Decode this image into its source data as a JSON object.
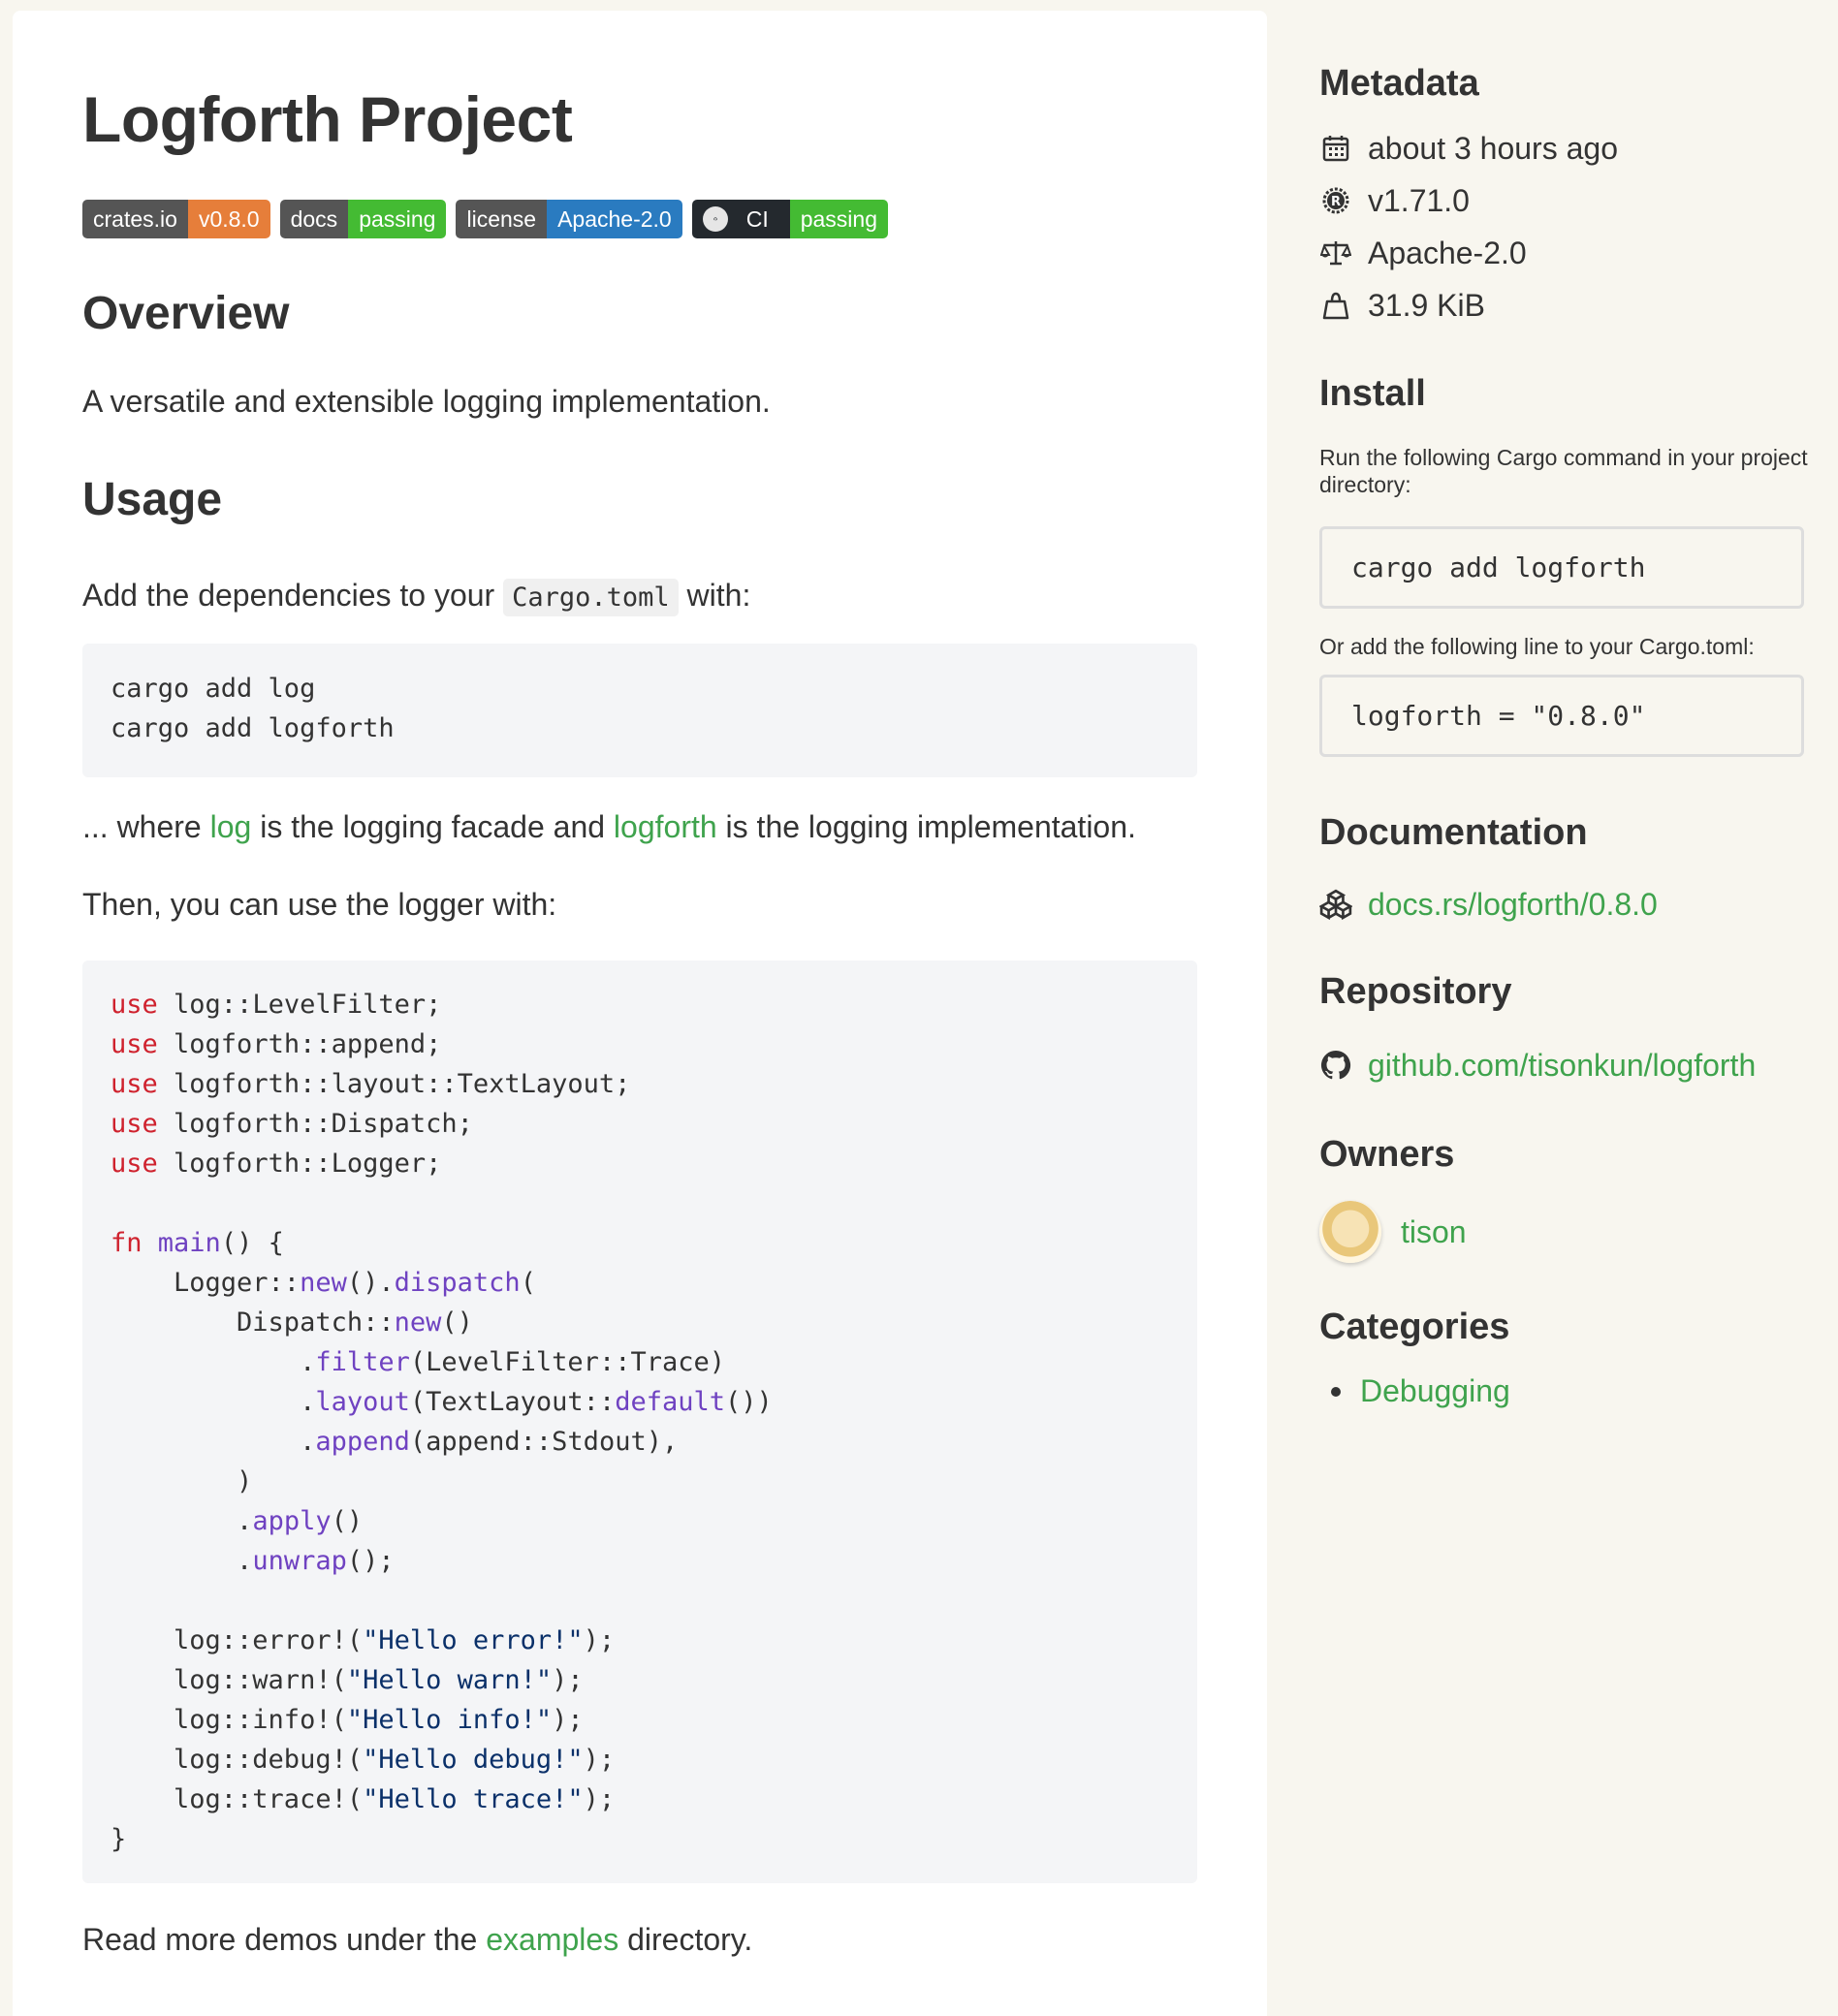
{
  "title": "Logforth Project",
  "badges": [
    {
      "left": "crates.io",
      "right": "v0.8.0"
    },
    {
      "left": "docs",
      "right": "passing"
    },
    {
      "left": "license",
      "right": "Apache-2.0"
    },
    {
      "left": "CI",
      "right": "passing"
    }
  ],
  "overview": {
    "heading": "Overview",
    "text": "A versatile and extensible logging implementation."
  },
  "usage": {
    "heading": "Usage",
    "add_text_before": "Add the dependencies to your ",
    "add_code": "Cargo.toml",
    "add_text_after": " with:",
    "cmd_lines": [
      "cargo add log",
      "cargo add logforth"
    ],
    "where_prefix": "... where ",
    "where_link1": "log",
    "where_mid": " is the logging facade and ",
    "where_link2": "logforth",
    "where_suffix": " is the logging implementation.",
    "then_text": "Then, you can use the logger with:",
    "read_prefix": "Read more demos under the ",
    "read_link": "examples",
    "read_suffix": " directory."
  },
  "code": [
    [
      [
        "kw",
        "use"
      ],
      [
        "t",
        " log::LevelFilter;"
      ]
    ],
    [
      [
        "kw",
        "use"
      ],
      [
        "t",
        " logforth::append;"
      ]
    ],
    [
      [
        "kw",
        "use"
      ],
      [
        "t",
        " logforth::layout::TextLayout;"
      ]
    ],
    [
      [
        "kw",
        "use"
      ],
      [
        "t",
        " logforth::Dispatch;"
      ]
    ],
    [
      [
        "kw",
        "use"
      ],
      [
        "t",
        " logforth::Logger;"
      ]
    ],
    [
      [
        "t",
        ""
      ]
    ],
    [
      [
        "kw",
        "fn"
      ],
      [
        "t",
        " "
      ],
      [
        "fn",
        "main"
      ],
      [
        "t",
        "() {"
      ]
    ],
    [
      [
        "t",
        "    Logger::"
      ],
      [
        "fn",
        "new"
      ],
      [
        "t",
        "()."
      ],
      [
        "fn",
        "dispatch"
      ],
      [
        "t",
        "("
      ]
    ],
    [
      [
        "t",
        "        Dispatch::"
      ],
      [
        "fn",
        "new"
      ],
      [
        "t",
        "()"
      ]
    ],
    [
      [
        "t",
        "            ."
      ],
      [
        "fn",
        "filter"
      ],
      [
        "t",
        "(LevelFilter::Trace)"
      ]
    ],
    [
      [
        "t",
        "            ."
      ],
      [
        "fn",
        "layout"
      ],
      [
        "t",
        "(TextLayout::"
      ],
      [
        "fn",
        "default"
      ],
      [
        "t",
        "())"
      ]
    ],
    [
      [
        "t",
        "            ."
      ],
      [
        "fn",
        "append"
      ],
      [
        "t",
        "(append::Stdout),"
      ]
    ],
    [
      [
        "t",
        "        )"
      ]
    ],
    [
      [
        "t",
        "        ."
      ],
      [
        "fn",
        "apply"
      ],
      [
        "t",
        "()"
      ]
    ],
    [
      [
        "t",
        "        ."
      ],
      [
        "fn",
        "unwrap"
      ],
      [
        "t",
        "();"
      ]
    ],
    [
      [
        "t",
        ""
      ]
    ],
    [
      [
        "t",
        "    log::error!("
      ],
      [
        "str",
        "\"Hello error!\""
      ],
      [
        "t",
        ");"
      ]
    ],
    [
      [
        "t",
        "    log::warn!("
      ],
      [
        "str",
        "\"Hello warn!\""
      ],
      [
        "t",
        ");"
      ]
    ],
    [
      [
        "t",
        "    log::info!("
      ],
      [
        "str",
        "\"Hello info!\""
      ],
      [
        "t",
        ");"
      ]
    ],
    [
      [
        "t",
        "    log::debug!("
      ],
      [
        "str",
        "\"Hello debug!\""
      ],
      [
        "t",
        ");"
      ]
    ],
    [
      [
        "t",
        "    log::trace!("
      ],
      [
        "str",
        "\"Hello trace!\""
      ],
      [
        "t",
        ");"
      ]
    ],
    [
      [
        "t",
        "}"
      ]
    ]
  ],
  "sidebar": {
    "metadata": {
      "heading": "Metadata",
      "items": [
        {
          "icon": "calendar-icon",
          "text": "about 3 hours ago"
        },
        {
          "icon": "rust-icon",
          "text": "v1.71.0"
        },
        {
          "icon": "scale-icon",
          "text": "Apache-2.0"
        },
        {
          "icon": "weight-icon",
          "text": "31.9 KiB"
        }
      ]
    },
    "install": {
      "heading": "Install",
      "text1": "Run the following Cargo command in your project directory:",
      "cmd1": "cargo add logforth",
      "text2": "Or add the following line to your Cargo.toml:",
      "cmd2": "logforth = \"0.8.0\""
    },
    "documentation": {
      "heading": "Documentation",
      "link": "docs.rs/logforth/0.8.0",
      "icon": "docs-rs-icon"
    },
    "repository": {
      "heading": "Repository",
      "link": "github.com/tisonkun/logforth",
      "icon": "github-icon"
    },
    "owners": {
      "heading": "Owners",
      "name": "tison"
    },
    "categories": {
      "heading": "Categories",
      "items": [
        "Debugging"
      ]
    }
  },
  "colors": {
    "link": "#3fa34d",
    "keyword": "#cf222e",
    "function": "#6f42c1",
    "string": "#0a3069",
    "badge_orange": "#e67e3a",
    "badge_green": "#44bb33",
    "badge_blue": "#2a7bc0"
  }
}
